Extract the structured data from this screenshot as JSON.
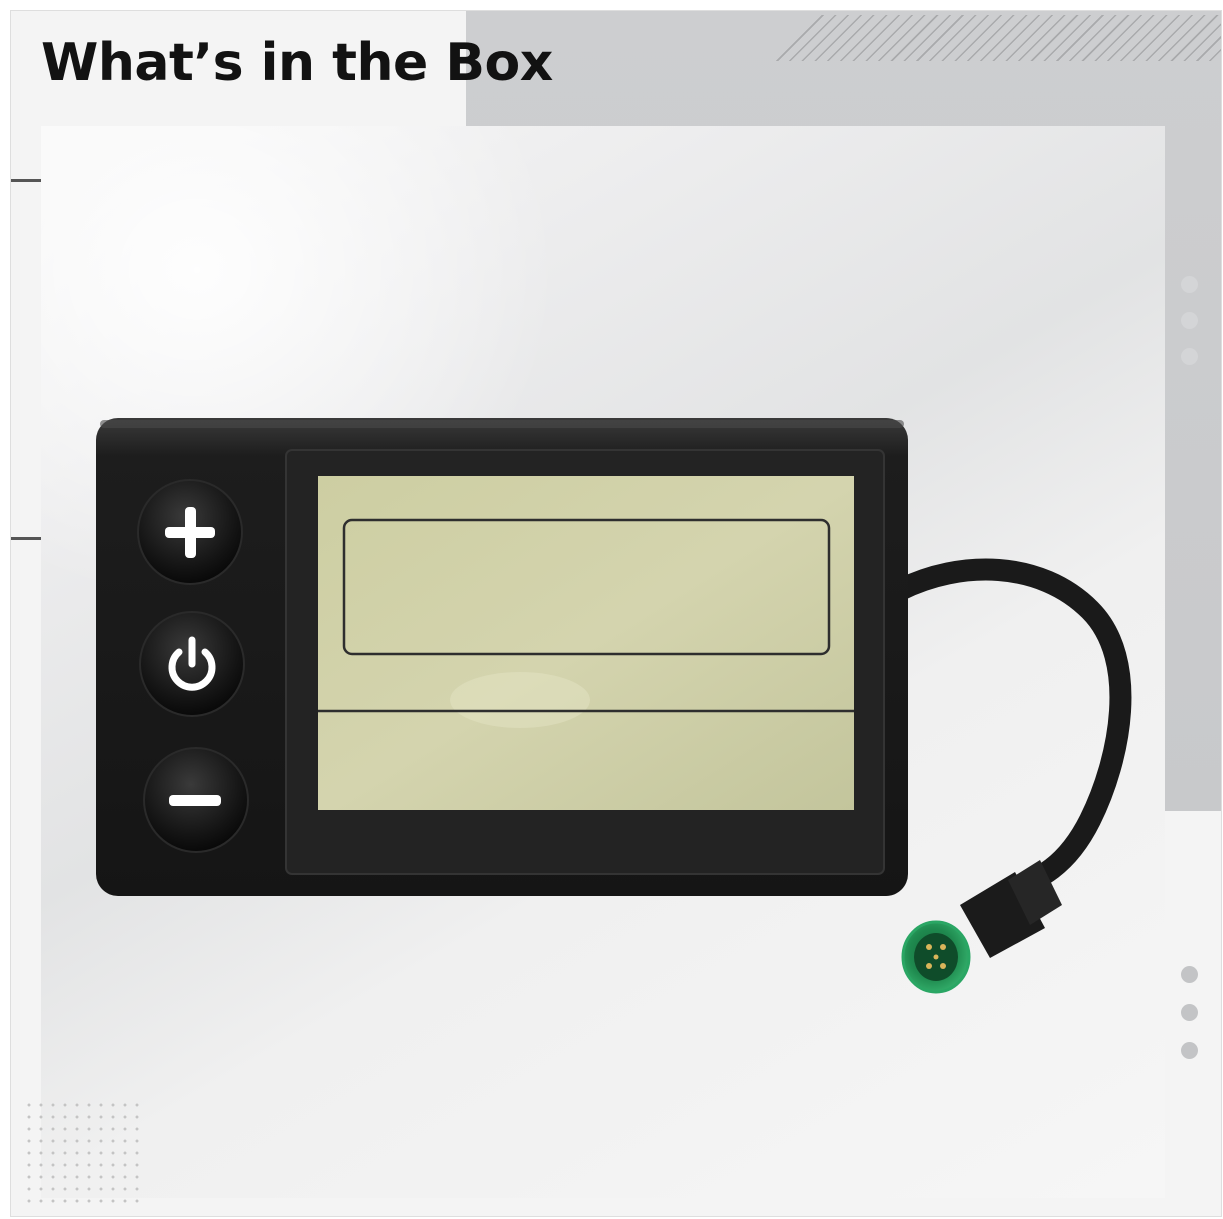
{
  "heading": "What’s in the Box",
  "device": {
    "buttons": [
      {
        "name": "plus-button",
        "icon": "plus-icon"
      },
      {
        "name": "power-button",
        "icon": "power-icon"
      },
      {
        "name": "minus-button",
        "icon": "minus-icon"
      }
    ],
    "connector_color": "#1f8a4f"
  },
  "colors": {
    "accent_gray": "#c9cacc",
    "lcd": "#cfd0a6"
  }
}
